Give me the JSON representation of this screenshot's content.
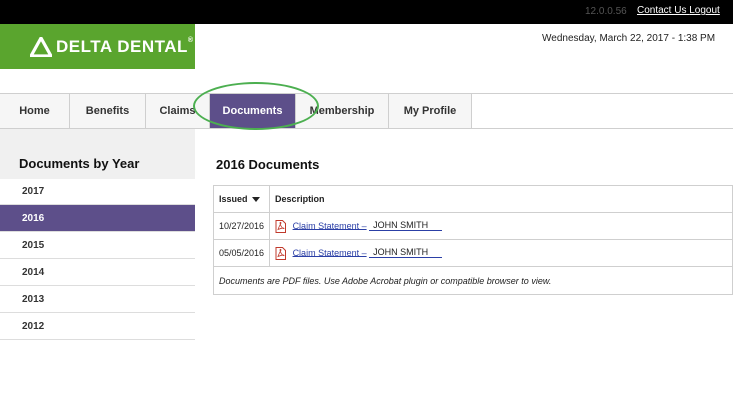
{
  "topbar": {
    "version": "12.0.0.56",
    "contact_label": "Contact Us",
    "logout_label": "Logout"
  },
  "brand": {
    "name": "DELTA DENTAL",
    "registered": "®",
    "color": "#5aa52e"
  },
  "header": {
    "datetime": "Wednesday, March 22, 2017 - 1:38 PM"
  },
  "nav": {
    "tabs": [
      {
        "label": "Home"
      },
      {
        "label": "Benefits"
      },
      {
        "label": "Claims"
      },
      {
        "label": "Documents",
        "active": true
      },
      {
        "label": "Membership"
      },
      {
        "label": "My Profile"
      }
    ],
    "active_color": "#5d4f8a"
  },
  "sidebar": {
    "title": "Documents by Year",
    "years": [
      "2017",
      "2016",
      "2015",
      "2014",
      "2013",
      "2012"
    ],
    "selected_year": "2016"
  },
  "main": {
    "title": "2016 Documents",
    "columns": [
      "Issued",
      "Description"
    ],
    "rows": [
      {
        "issued": "10/27/2016",
        "link": "Claim Statement –",
        "name": "JOHN SMITH"
      },
      {
        "issued": "05/05/2016",
        "link": "Claim Statement –",
        "name": "JOHN SMITH"
      }
    ],
    "note": "Documents are PDF files. Use Adobe Acrobat plugin or compatible browser to view."
  },
  "icons": {
    "logo": "delta-triangle-icon",
    "pdf": "pdf-file-icon",
    "sort": "sort-down-icon"
  }
}
